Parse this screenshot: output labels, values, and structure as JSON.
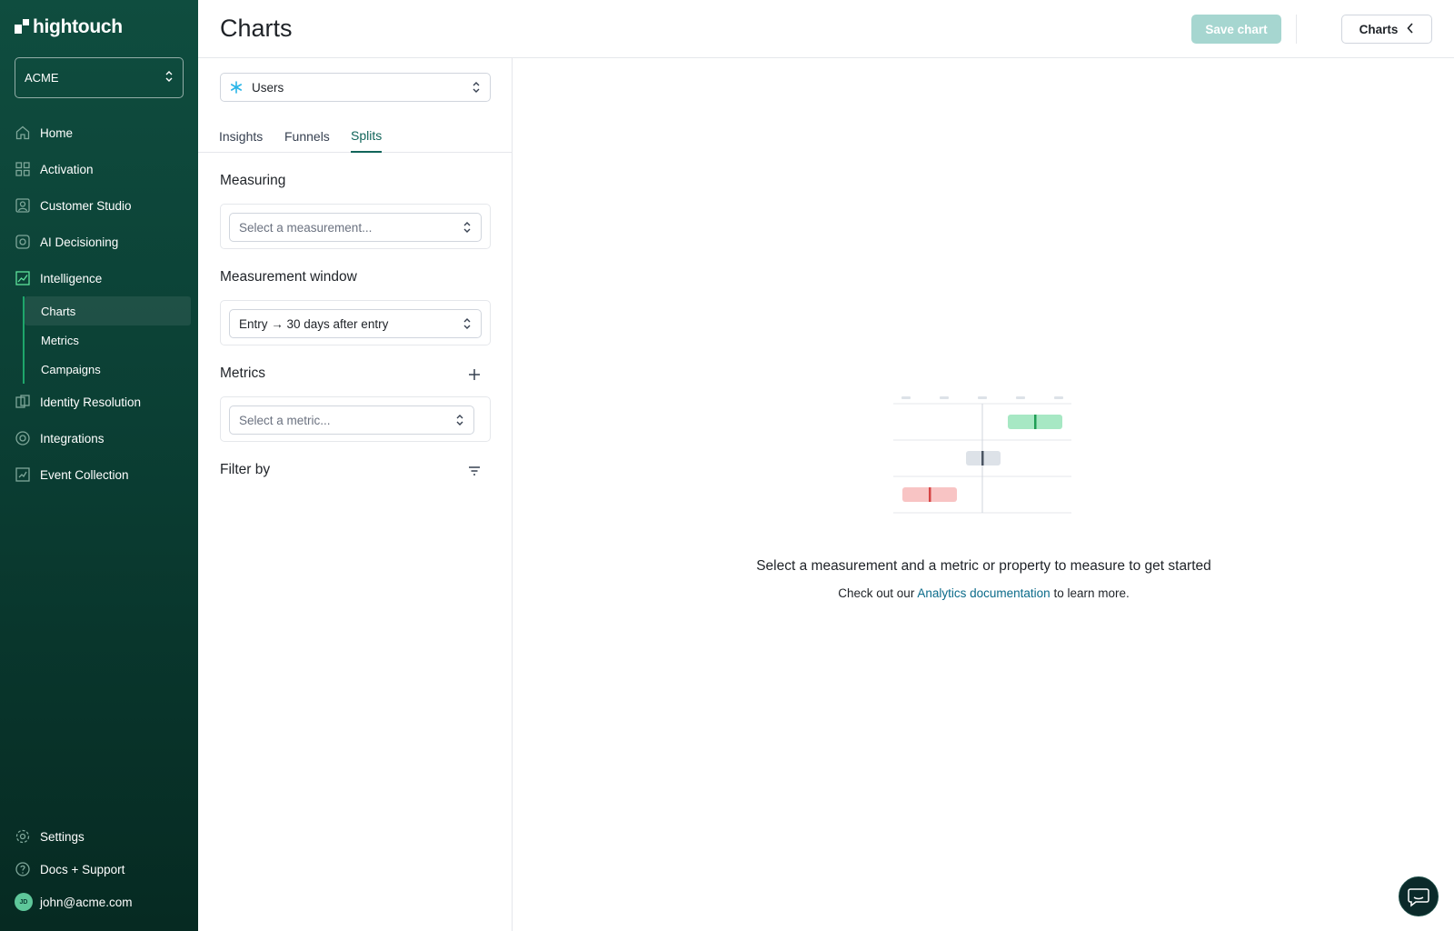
{
  "brand": {
    "name": "hightouch"
  },
  "workspace": {
    "name": "ACME"
  },
  "sidebar": {
    "items": [
      {
        "label": "Home",
        "icon": "home-icon"
      },
      {
        "label": "Activation",
        "icon": "grid-icon"
      },
      {
        "label": "Customer Studio",
        "icon": "user-square-icon"
      },
      {
        "label": "AI Decisioning",
        "icon": "ai-icon"
      },
      {
        "label": "Intelligence",
        "icon": "chart-icon"
      }
    ],
    "subitems": [
      {
        "label": "Charts"
      },
      {
        "label": "Metrics"
      },
      {
        "label": "Campaigns"
      }
    ],
    "items_after": [
      {
        "label": "Identity Resolution",
        "icon": "identity-icon"
      },
      {
        "label": "Integrations",
        "icon": "integrations-icon"
      },
      {
        "label": "Event Collection",
        "icon": "event-icon"
      }
    ],
    "bottom": {
      "settings": "Settings",
      "docs": "Docs + Support",
      "user_email": "john@acme.com",
      "user_initials": "JD"
    }
  },
  "header": {
    "title": "Charts",
    "save_label": "Save chart",
    "charts_label": "Charts"
  },
  "panel": {
    "parent_model": "Users",
    "tabs": [
      "Insights",
      "Funnels",
      "Splits"
    ],
    "active_tab": "Splits",
    "measuring": {
      "label": "Measuring",
      "placeholder": "Select a measurement..."
    },
    "window": {
      "label": "Measurement window",
      "value": "Entry → 30 days after entry"
    },
    "metrics": {
      "label": "Metrics",
      "placeholder": "Select a metric..."
    },
    "filter": {
      "label": "Filter by"
    }
  },
  "empty_state": {
    "title": "Select a measurement and a metric or property to measure to get started",
    "sub_prefix": "Check out our",
    "link": "Analytics documentation",
    "sub_suffix": "to learn more."
  },
  "colors": {
    "sidebar_top": "#0f4d3f",
    "accent": "#11655a",
    "active_nav_icon": "#5ee39c",
    "positive": "#a7e8c4",
    "neutral": "#dde2e8",
    "negative": "#f8c4c4"
  }
}
